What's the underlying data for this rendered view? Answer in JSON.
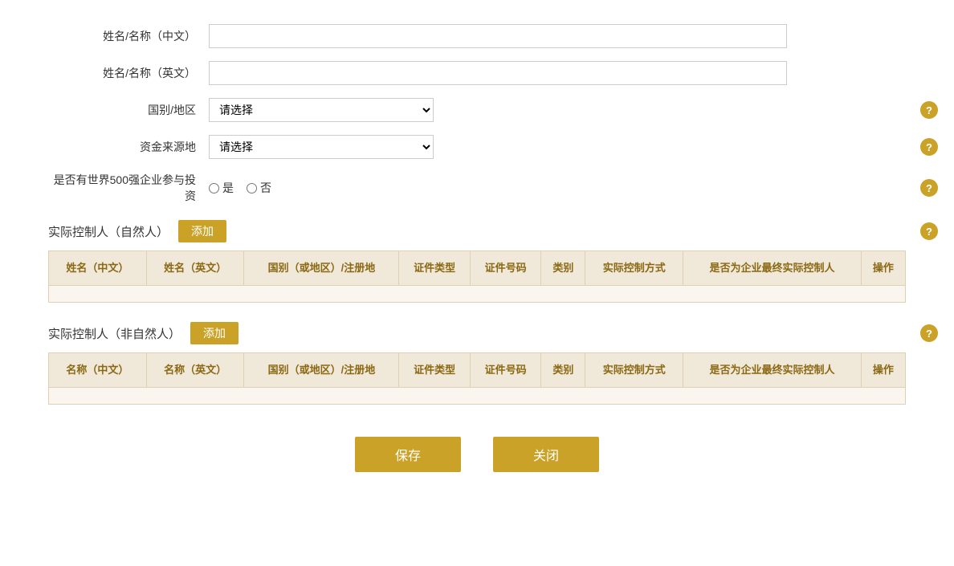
{
  "form": {
    "name_cn_label": "姓名/名称（中文）",
    "name_cn_placeholder": "",
    "name_en_label": "姓名/名称（英文）",
    "name_en_placeholder": "",
    "country_label": "国别/地区",
    "country_placeholder": "请选择",
    "fund_source_label": "资金来源地",
    "fund_source_placeholder": "请选择",
    "fortune500_label": "是否有世界500强企业参与投资",
    "radio_yes": "是",
    "radio_no": "否"
  },
  "natural_controller": {
    "title": "实际控制人（自然人）",
    "add_label": "添加",
    "help_icon": "?",
    "columns": [
      "姓名（中文）",
      "姓名（英文）",
      "国别（或地区）/注册地",
      "证件类型",
      "证件号码",
      "类别",
      "实际控制方式",
      "是否为企业最终实际控制人",
      "操作"
    ]
  },
  "non_natural_controller": {
    "title": "实际控制人（非自然人）",
    "add_label": "添加",
    "help_icon": "?",
    "columns": [
      "名称（中文）",
      "名称（英文）",
      "国别（或地区）/注册地",
      "证件类型",
      "证件号码",
      "类别",
      "实际控制方式",
      "是否为企业最终实际控制人",
      "操作"
    ]
  },
  "buttons": {
    "save": "保存",
    "close": "关闭"
  }
}
